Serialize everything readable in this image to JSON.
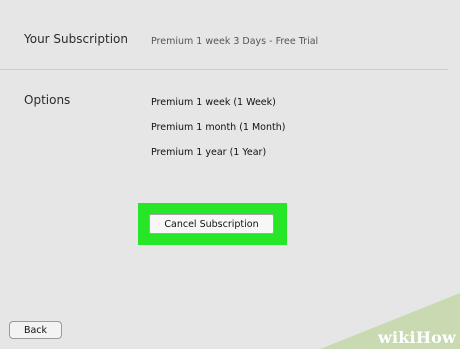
{
  "subscription": {
    "label": "Your Subscription",
    "current": "Premium 1 week 3 Days - Free Trial"
  },
  "options": {
    "label": "Options",
    "items": [
      "Premium 1 week (1 Week)",
      "Premium 1 month (1 Month)",
      "Premium 1 year (1 Year)"
    ]
  },
  "actions": {
    "cancel_label": "Cancel Subscription",
    "back_label": "Back"
  },
  "highlight_color": "#27e627",
  "watermark": {
    "prefix": "wiki",
    "suffix": "How"
  }
}
